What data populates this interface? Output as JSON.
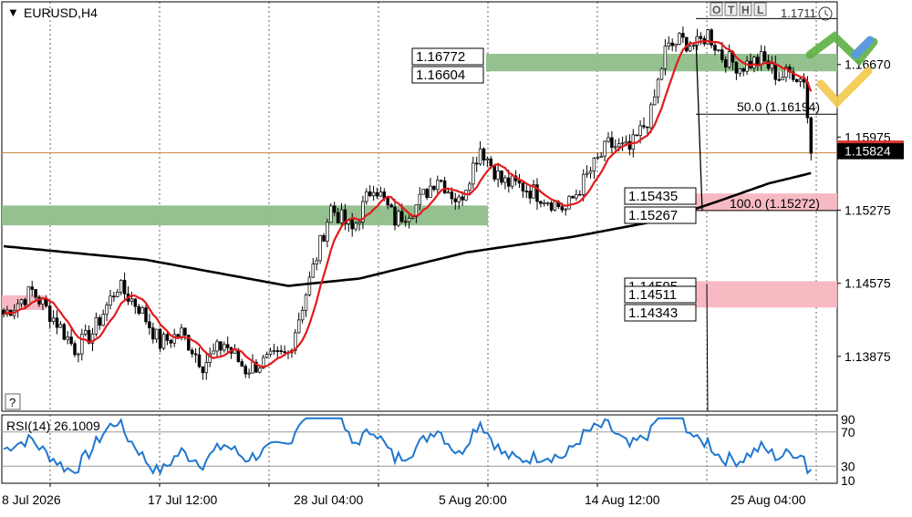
{
  "window": {
    "symbol_title": "EURUSD,H4",
    "help_button": "?",
    "toolbar_buttons": [
      "O",
      "T",
      "H",
      "L"
    ],
    "trade_panel_text": "1.1711"
  },
  "chart_data": {
    "type": "candlestick",
    "title": "EURUSD,H4",
    "x_tick_labels": [
      "8 Jul 2026",
      "17 Jul 12:00",
      "28 Jul 04:00",
      "5 Aug 20:00",
      "14 Aug 12:00",
      "25 Aug 04:00"
    ],
    "y_tick_labels": [
      "1.16670",
      "1.15975",
      "1.15275",
      "1.14575",
      "1.13875"
    ],
    "y_tick_values": [
      1.1667,
      1.15975,
      1.15275,
      1.14575,
      1.13875
    ],
    "ylim": [
      1.1335,
      1.1727
    ],
    "current_price": "1.15824",
    "current_price_value": 1.15824,
    "grid": true,
    "ohlc_description": "EURUSD H4 candles from 8 Jul to 27 Aug: decline to ~1.137, rally to ~1.169, pullback, sharp drop to ~1.158",
    "anchor_closes": [
      [
        0,
        1.1428
      ],
      [
        8,
        1.145
      ],
      [
        15,
        1.142
      ],
      [
        20,
        1.1395
      ],
      [
        25,
        1.141
      ],
      [
        32,
        1.1455
      ],
      [
        38,
        1.1435
      ],
      [
        44,
        1.14
      ],
      [
        50,
        1.141
      ],
      [
        56,
        1.138
      ],
      [
        62,
        1.14
      ],
      [
        68,
        1.1375
      ],
      [
        74,
        1.1383
      ],
      [
        80,
        1.139
      ],
      [
        86,
        1.146
      ],
      [
        92,
        1.153
      ],
      [
        98,
        1.1508
      ],
      [
        104,
        1.1553
      ],
      [
        110,
        1.1518
      ],
      [
        116,
        1.1532
      ],
      [
        122,
        1.156
      ],
      [
        128,
        1.1535
      ],
      [
        134,
        1.1588
      ],
      [
        140,
        1.1555
      ],
      [
        146,
        1.155
      ],
      [
        152,
        1.154
      ],
      [
        158,
        1.1528
      ],
      [
        164,
        1.156
      ],
      [
        170,
        1.159
      ],
      [
        176,
        1.1585
      ],
      [
        182,
        1.162
      ],
      [
        186,
        1.168
      ],
      [
        190,
        1.169
      ],
      [
        195,
        1.1685
      ],
      [
        198,
        1.1697
      ],
      [
        202,
        1.1675
      ],
      [
        207,
        1.1665
      ],
      [
        213,
        1.1672
      ],
      [
        218,
        1.1655
      ],
      [
        222,
        1.166
      ],
      [
        225,
        1.165
      ],
      [
        227,
        1.1582
      ]
    ],
    "series": [
      {
        "name": "EURUSD,H4",
        "kind": "candles",
        "color": "#000000"
      },
      {
        "name": "MA fast",
        "kind": "line",
        "color": "#e31a1c"
      },
      {
        "name": "MA slow",
        "kind": "line",
        "color": "#000000"
      }
    ],
    "zones": [
      {
        "kind": "resistance",
        "from": 1.16604,
        "to": 1.16772,
        "color": "#8fbe8a"
      },
      {
        "kind": "resistance",
        "from": 1.1513,
        "to": 1.1532,
        "color": "#8fbe8a"
      },
      {
        "kind": "support",
        "from": 1.15267,
        "to": 1.15435,
        "color": "#f7b6c0"
      },
      {
        "kind": "support",
        "from": 1.14343,
        "to": 1.14595,
        "color": "#f7b6c0"
      },
      {
        "kind": "support",
        "from": 1.1432,
        "to": 1.1446,
        "color": "#f7b6c0"
      }
    ],
    "price_labels": [
      {
        "text": "1.16772",
        "value": 1.16772
      },
      {
        "text": "1.16604",
        "value": 1.16604
      },
      {
        "text": "1.15435",
        "value": 1.15435
      },
      {
        "text": "1.15267",
        "value": 1.15267
      },
      {
        "text": "1.14595",
        "value": 1.14595
      },
      {
        "text": "1.14511",
        "value": 1.14511
      },
      {
        "text": "1.14343",
        "value": 1.14343
      }
    ],
    "fibonacci": {
      "level_50_label": "50.0 (1.16194)",
      "level_50_value": 1.16194,
      "level_100_label": "100.0 (1.15272)",
      "level_100_value": 1.15272
    },
    "rsi": {
      "label": "RSI(14) 26.1009",
      "value": 26.1009,
      "levels": [
        30,
        70
      ],
      "axis_labels": [
        "90",
        "70",
        "30",
        "10"
      ],
      "ylim": [
        10,
        90
      ],
      "color": "#1f77d0"
    }
  }
}
